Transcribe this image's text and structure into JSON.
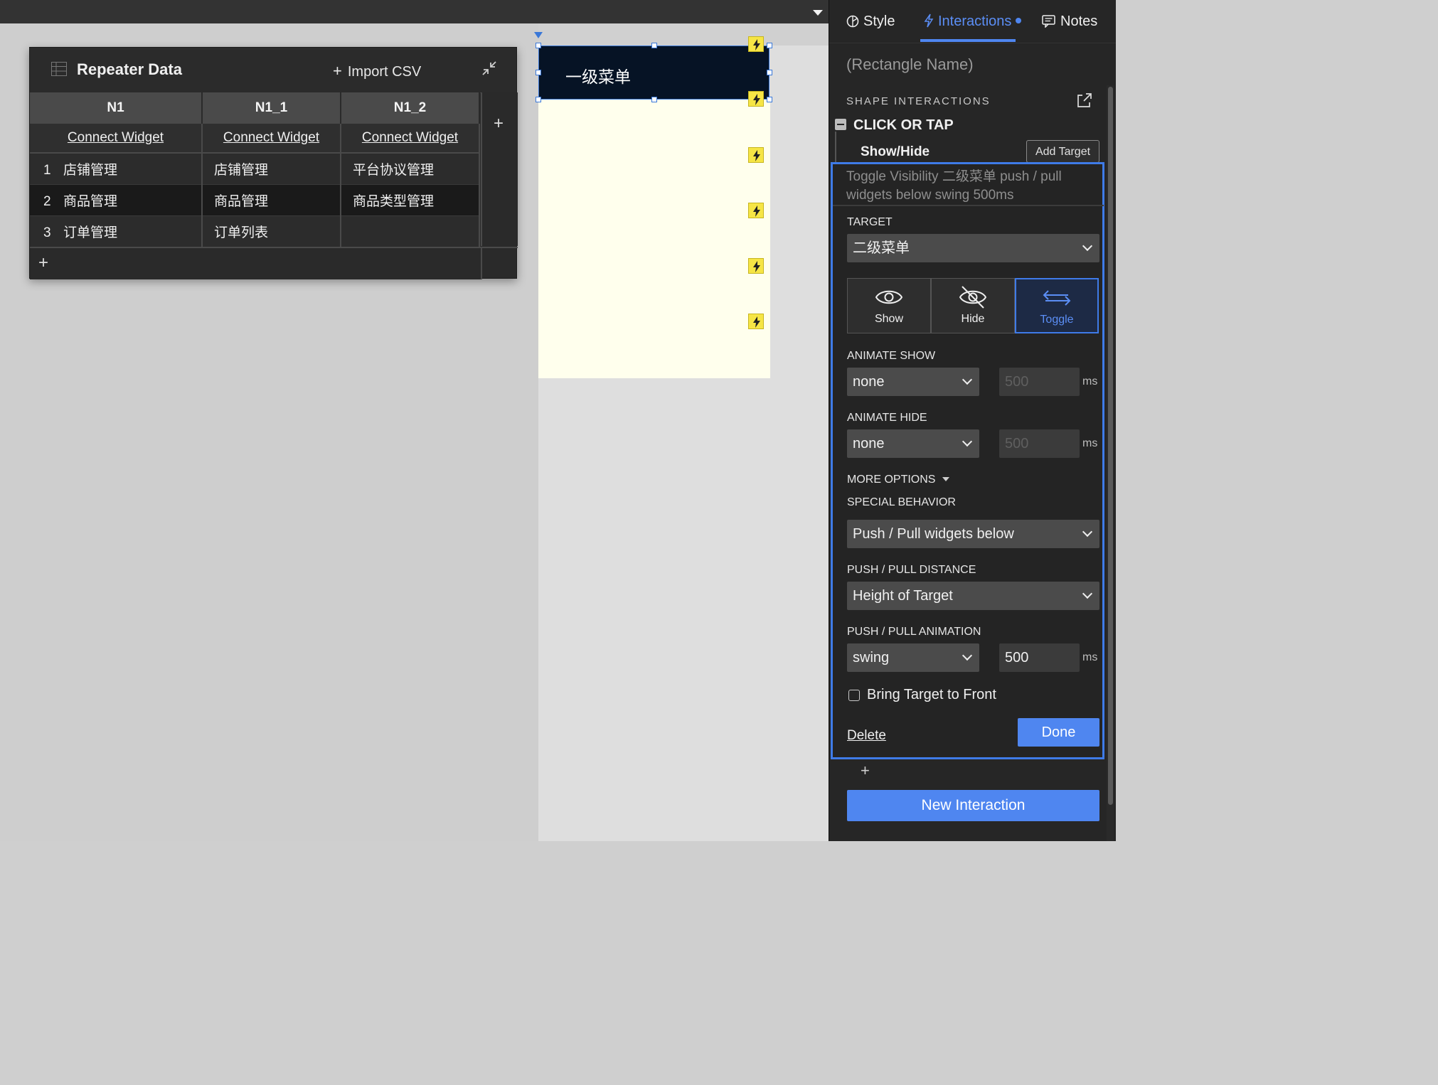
{
  "repeater": {
    "title": "Repeater Data",
    "import_label": "Import CSV",
    "columns": [
      "N1",
      "N1_1",
      "N1_2"
    ],
    "connect_label": "Connect Widget",
    "rows": [
      {
        "num": "1",
        "cells": [
          "店铺管理",
          "店铺管理",
          "平台协议管理"
        ]
      },
      {
        "num": "2",
        "cells": [
          "商品管理",
          "商品管理",
          "商品类型管理"
        ]
      },
      {
        "num": "3",
        "cells": [
          "订单管理",
          "订单列表",
          ""
        ]
      }
    ],
    "add_symbol": "+"
  },
  "canvas": {
    "menu_l1_label": "一级菜单",
    "colors": {
      "menu_l1_bg": "#061325",
      "menu_bg": "#ffffed",
      "selection": "#3a78d8",
      "bolt": "#f6e545"
    }
  },
  "panel": {
    "tabs": {
      "style": "Style",
      "interactions": "Interactions",
      "notes": "Notes"
    },
    "rect_name": "(Rectangle Name)",
    "section_title": "SHAPE INTERACTIONS",
    "event_label": "CLICK OR TAP",
    "action_label": "Show/Hide",
    "add_target": "Add Target",
    "summary": "Toggle Visibility 二级菜单  push / pull widgets below swing 500ms",
    "target_label": "TARGET",
    "target_value": "二级菜单",
    "show_label": "Show",
    "hide_label": "Hide",
    "toggle_label": "Toggle",
    "animate_show_label": "ANIMATE SHOW",
    "animate_show_value": "none",
    "animate_show_ms": "500",
    "animate_hide_label": "ANIMATE HIDE",
    "animate_hide_value": "none",
    "animate_hide_ms": "500",
    "ms": "ms",
    "more_options": "MORE OPTIONS",
    "special_behavior_label": "SPECIAL BEHAVIOR",
    "special_behavior_value": "Push / Pull widgets below",
    "push_distance_label": "PUSH / PULL DISTANCE",
    "push_distance_value": "Height of Target",
    "push_animation_label": "PUSH / PULL ANIMATION",
    "push_animation_value": "swing",
    "push_animation_ms": "500",
    "bring_front": "Bring Target to Front",
    "delete": "Delete",
    "done": "Done",
    "add_action": "+",
    "new_interaction": "New Interaction",
    "accent": "#4f86f0"
  }
}
